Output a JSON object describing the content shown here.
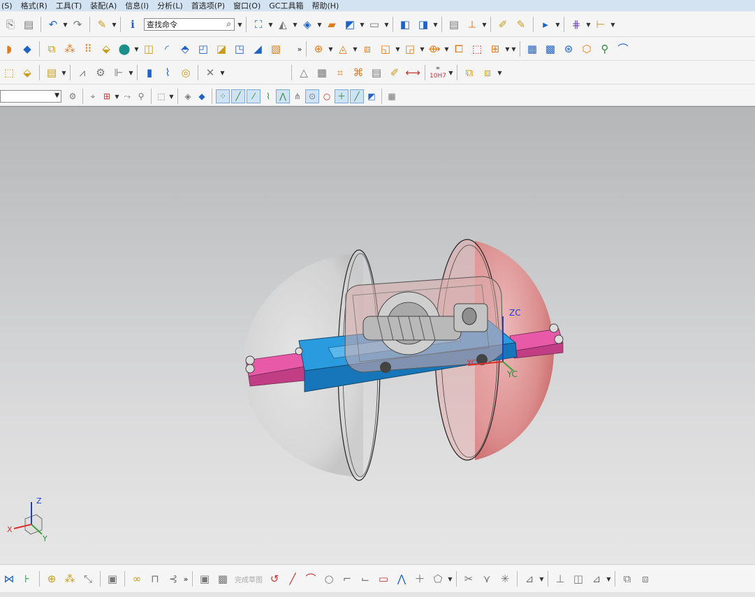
{
  "menu": [
    "(S)",
    "格式(R)",
    "工具(T)",
    "装配(A)",
    "信息(I)",
    "分析(L)",
    "首选项(P)",
    "窗口(O)",
    "GC工具箱",
    "帮助(H)"
  ],
  "search": {
    "value": "查找命令"
  },
  "toolbar3": {
    "fit_label": "10H7"
  },
  "bottombar": {
    "finish_sketch_label": "完成草图"
  },
  "more_glyph": "»",
  "viewport": {
    "csys_labels": {
      "z": "ZC",
      "y": "YC",
      "x": "XC"
    },
    "triad_labels": {
      "z": "Z",
      "x": "X",
      "y": "Y"
    }
  },
  "colors": {
    "menubar_bg": "#d4e3f2",
    "viewport_top": "#b5b6b8",
    "viewport_bottom": "#e6e6e6",
    "rail_pink": "#e85aa8",
    "base_blue": "#1f8fd8",
    "sphere_red": "#d9605f",
    "sphere_gray": "#cfcfcf"
  },
  "icons": {
    "toolbar1": [
      "copy-icon",
      "paste-icon",
      "undo-icon",
      "redo-icon",
      "palette-icon",
      "info-icon",
      "fit-view-icon",
      "shaded-view-icon",
      "cube-view-icon",
      "orient-icon",
      "layer-icon",
      "window-icon",
      "measure-icon",
      "part-nav-icon",
      "sketch-icon",
      "feature-icon",
      "assembly-icon",
      "snap-icon",
      "ruler-icon"
    ],
    "toolbar4": [
      "filter-icon",
      "selection-icon",
      "endpoint-snap-icon",
      "midpoint-snap-icon",
      "point-snap-icon",
      "arc-center-icon",
      "quadrant-icon",
      "intersection-icon",
      "grid-icon"
    ]
  }
}
